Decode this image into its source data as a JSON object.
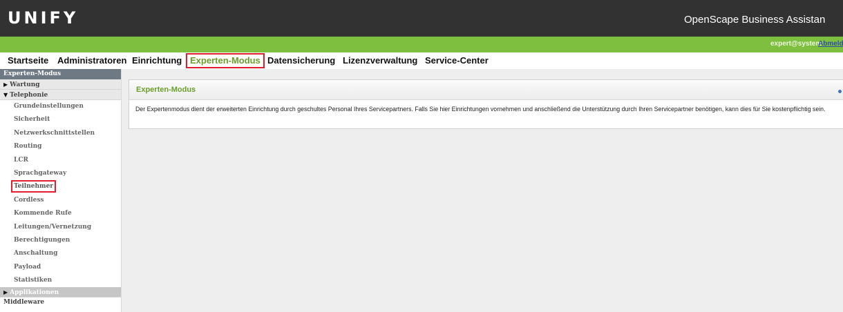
{
  "header": {
    "logo": "UNIFY",
    "app_title": "OpenScape Business Assistan"
  },
  "userbar": {
    "user": "expert@system",
    "logout": "Abmeld"
  },
  "topnav": [
    {
      "label": "Startseite"
    },
    {
      "label": "Administratoren"
    },
    {
      "label": "Einrichtung"
    },
    {
      "label": "Experten-Modus",
      "active": true
    },
    {
      "label": "Datensicherung"
    },
    {
      "label": "Lizenzverwaltung"
    },
    {
      "label": "Service-Center"
    }
  ],
  "sidebar": {
    "header": "Experten-Modus",
    "group_wartung": "Wartung",
    "group_telephonie": "Telephonie",
    "items": [
      "Grundeinstellungen",
      "Sicherheit",
      "Netzwerkschnittstellen",
      "Routing",
      "LCR",
      "Sprachgateway",
      "Teilnehmer",
      "Cordless",
      "Kommende Rufe",
      "Leitungen/Vernetzung",
      "Berechtigungen",
      "Anschaltung",
      "Payload",
      "Statistiken"
    ],
    "group_applikationen": "Applikationen",
    "bottom": "Middleware"
  },
  "panel": {
    "title": "Experten-Modus",
    "text": "Der Expertenmodus dient der erweiterten Einrichtung durch geschultes Personal Ihres Servicepartners. Falls Sie hier Einrichtungen vornehmen und anschließend die Unterstützung durch Ihren Servicepartner benötigen, kann dies für Sie kostenpflichtig sein."
  },
  "colors": {
    "header_bg": "#323232",
    "green_bar": "#7fbf3f",
    "accent_green": "#6a9f2a",
    "highlight_red": "#e01e2e",
    "sidebar_header": "#6e7984"
  }
}
